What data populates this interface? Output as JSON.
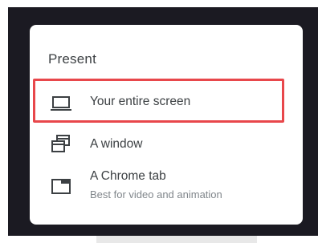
{
  "dialog": {
    "title": "Present",
    "items": [
      {
        "label": "Your entire screen",
        "icon": "laptop-icon"
      },
      {
        "label": "A window",
        "icon": "window-icon"
      },
      {
        "label": "A Chrome tab",
        "sublabel": "Best for video and animation",
        "icon": "tab-icon"
      }
    ]
  },
  "colors": {
    "highlight": "#e8474b",
    "background": "#1b1a22",
    "text": "#3c4043",
    "subtext": "#80868b"
  }
}
